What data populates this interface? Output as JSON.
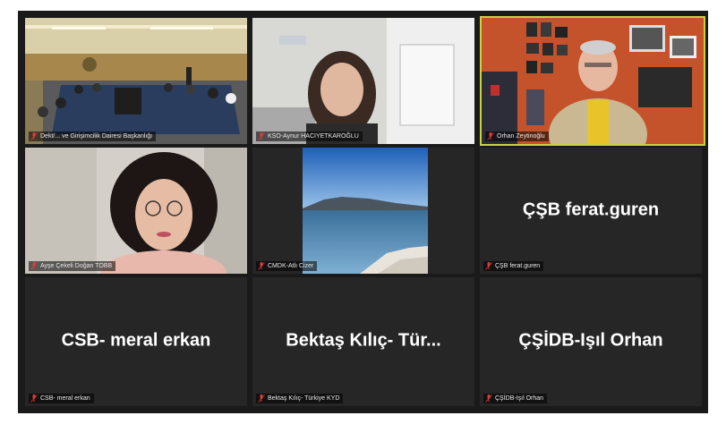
{
  "meeting": {
    "participants": [
      {
        "id": "p1",
        "label": "Dekt/... ve Girişimcilik Dairesi Başkanlığı",
        "muted": true,
        "video": true,
        "scene": "conference-room"
      },
      {
        "id": "p2",
        "label": "KSO-Aynur HACIYETKAROĞLU",
        "muted": true,
        "video": true,
        "scene": "woman-office"
      },
      {
        "id": "p3",
        "label": "Orhan Zeytinoğlu",
        "muted": true,
        "video": true,
        "active_speaker": true,
        "scene": "man-office"
      },
      {
        "id": "p4",
        "label": "Ayşe Çekeli Doğan TOBB",
        "muted": true,
        "video": true,
        "scene": "woman-glasses"
      },
      {
        "id": "p5",
        "label": "CMDK-Atlı Cizer",
        "muted": true,
        "video": true,
        "scene": "lake-photo"
      },
      {
        "id": "p6",
        "label": "ÇŞB ferat.guren",
        "display_name": "ÇŞB ferat.guren",
        "muted": true,
        "video": false
      },
      {
        "id": "p7",
        "label": "CSB- meral erkan",
        "display_name": "CSB- meral erkan",
        "muted": true,
        "video": false
      },
      {
        "id": "p8",
        "label": "Bektaş Kılıç- Türkiye KYD",
        "display_name": "Bektaş Kılıç- Tür...",
        "muted": true,
        "video": false
      },
      {
        "id": "p9",
        "label": "ÇŞİDB-Işıl Orhan",
        "display_name": "ÇŞİDB-Işıl Orhan",
        "muted": true,
        "video": false
      }
    ]
  },
  "colors": {
    "grid_background": "#1a1a1a",
    "tile_background": "#262626",
    "active_speaker_border": "#c9d43a",
    "muted_icon": "#e03b3b"
  },
  "icons": {
    "muted": "mic-muted-icon"
  }
}
